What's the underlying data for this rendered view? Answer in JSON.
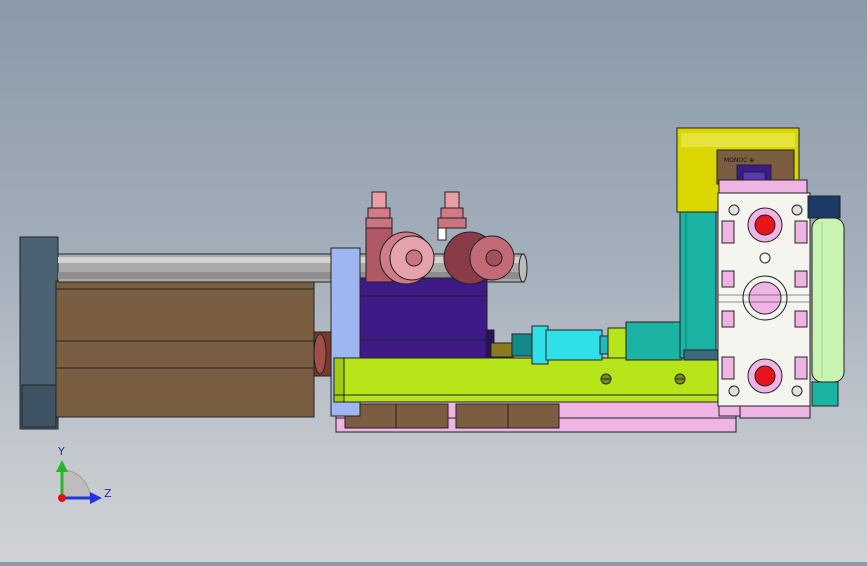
{
  "scene": {
    "background_top": "#8b99a8",
    "background_bottom": "#d0d2d5",
    "part_label": "MONOC ⊕"
  },
  "triad": {
    "y_label": "Y",
    "z_label": "Z",
    "y_color": "#22bb22",
    "z_color": "#2233dd",
    "x_color": "#dd1111"
  },
  "colors": {
    "motor_body": "#7a5e41",
    "motor_flange": "#4a6272",
    "rod": "#a9a9a9",
    "plate_blue": "#9fb7f0",
    "block_purple": "#3d1a86",
    "roller_pink": "#d07b86",
    "base_green": "#b6e619",
    "rail_pink": "#f0b4e4",
    "bracket_yellow": "#d9d600",
    "teal": "#1bb3a3",
    "cyan": "#2fe0e6",
    "valve_white": "#f5f5f0",
    "knob_red": "#e8141c",
    "roller_green": "#c9f3b0"
  }
}
